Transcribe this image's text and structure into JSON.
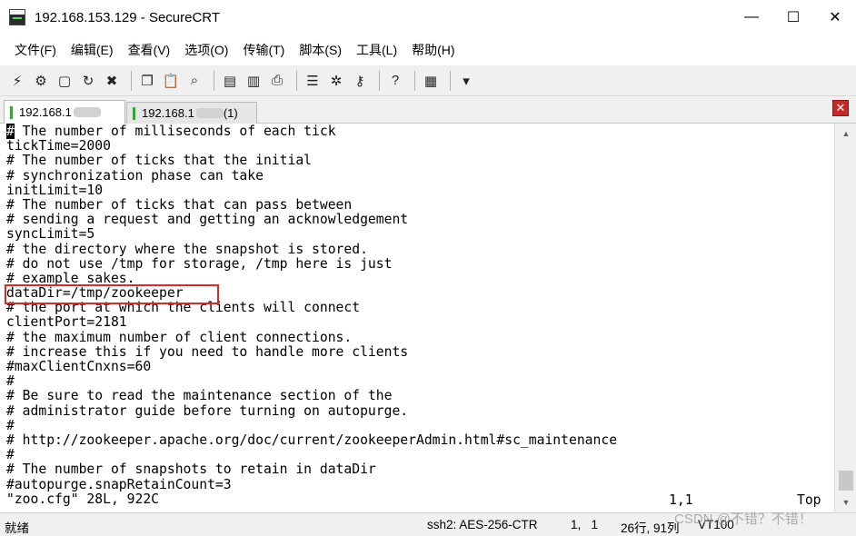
{
  "window": {
    "title": "192.168.153.129 - SecureCRT",
    "minimize_glyph": "—",
    "maximize_glyph": "☐",
    "close_glyph": "✕"
  },
  "menu": [
    "文件(F)",
    "编辑(E)",
    "查看(V)",
    "选项(O)",
    "传输(T)",
    "脚本(S)",
    "工具(L)",
    "帮助(H)"
  ],
  "toolbar": {
    "icons": [
      {
        "name": "connect-icon",
        "glyph": "⚡"
      },
      {
        "name": "quick-connect-icon",
        "glyph": "⚙"
      },
      {
        "name": "connect-in-tab-icon",
        "glyph": "▢"
      },
      {
        "name": "reconnect-icon",
        "glyph": "↻"
      },
      {
        "name": "disconnect-icon",
        "glyph": "✖"
      },
      {
        "name": "copy-icon",
        "glyph": "❐"
      },
      {
        "name": "paste-icon",
        "glyph": "📋"
      },
      {
        "name": "find-icon",
        "glyph": "⌕"
      },
      {
        "name": "print-setup-icon",
        "glyph": "▤"
      },
      {
        "name": "print-selection-icon",
        "glyph": "▥"
      },
      {
        "name": "print-icon",
        "glyph": "⎙"
      },
      {
        "name": "session-options-icon",
        "glyph": "☰"
      },
      {
        "name": "global-options-icon",
        "glyph": "✲"
      },
      {
        "name": "key-map-icon",
        "glyph": "⚷"
      },
      {
        "name": "help-icon",
        "glyph": "?"
      },
      {
        "name": "sftp-icon",
        "glyph": "▦"
      },
      {
        "name": "toolbar-overflow-icon",
        "glyph": "▾"
      }
    ]
  },
  "tabs": [
    {
      "label": "192.168.1",
      "suffix": "",
      "active": true
    },
    {
      "label": "192.168.1",
      "suffix": "(1)",
      "active": false
    }
  ],
  "terminal": {
    "lines": [
      "# The number of milliseconds of each tick",
      "tickTime=2000",
      "# The number of ticks that the initial",
      "# synchronization phase can take",
      "initLimit=10",
      "# The number of ticks that can pass between",
      "# sending a request and getting an acknowledgement",
      "syncLimit=5",
      "# the directory where the snapshot is stored.",
      "# do not use /tmp for storage, /tmp here is just",
      "# example sakes.",
      "dataDir=/tmp/zookeeper",
      "# the port at which the clients will connect",
      "clientPort=2181",
      "# the maximum number of client connections.",
      "# increase this if you need to handle more clients",
      "#maxClientCnxns=60",
      "#",
      "# Be sure to read the maintenance section of the",
      "# administrator guide before turning on autopurge.",
      "#",
      "# http://zookeeper.apache.org/doc/current/zookeeperAdmin.html#sc_maintenance",
      "#",
      "# The number of snapshots to retain in dataDir",
      "#autopurge.snapRetainCount=3",
      "\"zoo.cfg\" 28L, 922C"
    ],
    "cursor_position": "1,1",
    "scroll_position": "Top"
  },
  "statusbar": {
    "ready": "就绪",
    "encryption": "ssh2: AES-256-CTR",
    "row_col": "1,   1",
    "rows_cols": "26行, 91列",
    "emulation": "VT100"
  },
  "watermark": "CSDN @不错？不错！",
  "colors": {
    "highlight_box": "#d62b2b",
    "tab_status_connected": "#22b322",
    "close_tab_button": "#c62828"
  }
}
